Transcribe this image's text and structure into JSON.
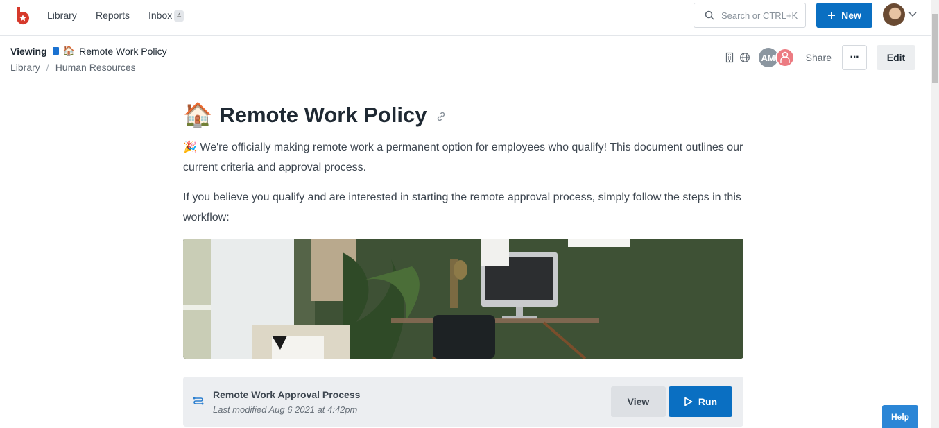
{
  "nav": {
    "library": "Library",
    "reports": "Reports",
    "inbox": "Inbox",
    "inbox_count": "4"
  },
  "search": {
    "placeholder": "Search or CTRL+K"
  },
  "new_button": "New",
  "subheader": {
    "viewing_label": "Viewing",
    "doc_emoji": "🏠",
    "doc_title": "Remote Work Policy",
    "breadcrumb": [
      "Library",
      "Human Resources"
    ],
    "avatar_initials": "AM",
    "share_label": "Share",
    "more_label": "···",
    "edit_label": "Edit"
  },
  "doc": {
    "title_emoji": "🏠",
    "title": "Remote Work Policy",
    "para1_emoji": "🎉",
    "para1": "We're officially making remote work a permanent option for employees who qualify! This document outlines our current criteria and approval process.",
    "para2": "If you believe you qualify and are interested in starting the remote approval process, simply follow the steps in this workflow:"
  },
  "workflow": {
    "name": "Remote Work Approval Process",
    "modified": "Last modified Aug 6 2021 at 4:42pm",
    "view_label": "View",
    "run_label": "Run"
  },
  "help_label": "Help",
  "colors": {
    "primary": "#0a6fc2",
    "logo": "#d6392b"
  }
}
